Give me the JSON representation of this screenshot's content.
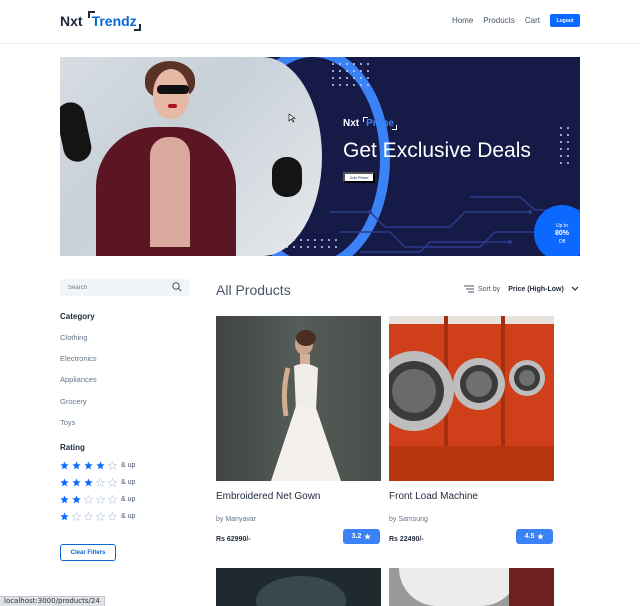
{
  "header": {
    "logo_prefix": "Nxt",
    "logo_highlight": "Trendz",
    "nav": [
      "Home",
      "Products",
      "Cart"
    ],
    "logout_label": "Logout"
  },
  "banner": {
    "prime_prefix": "Nxt",
    "prime_highlight": "Prime",
    "title": "Get Exclusive Deals",
    "join_label": "Join Prime",
    "offer_top": "Up to",
    "offer_value": "80%",
    "offer_bottom": "Off"
  },
  "sidebar": {
    "search_placeholder": "Search",
    "category_title": "Category",
    "categories": [
      "Clothing",
      "Electronics",
      "Appliances",
      "Grocery",
      "Toys"
    ],
    "rating_title": "Rating",
    "ratings": [
      {
        "filled": 4,
        "label": "& up"
      },
      {
        "filled": 3,
        "label": "& up"
      },
      {
        "filled": 2,
        "label": "& up"
      },
      {
        "filled": 1,
        "label": "& up"
      }
    ],
    "clear_label": "Clear Filters"
  },
  "main": {
    "heading": "All Products",
    "sort_label": "Sort by",
    "sort_value": "Price (High-Low)",
    "products": [
      {
        "title": "Embroidered Net Gown",
        "brand": "by Manyavar",
        "price": "Rs 62990/-",
        "rating": "3.2"
      },
      {
        "title": "Front Load Machine",
        "brand": "by Samsung",
        "price": "Rs 22490/-",
        "rating": "4.5"
      }
    ]
  },
  "status_bar": "localhost:3000/products/24",
  "colors": {
    "accent": "#0b69ff",
    "banner_bg": "#161a47",
    "rating_badge": "#3b82f6"
  }
}
